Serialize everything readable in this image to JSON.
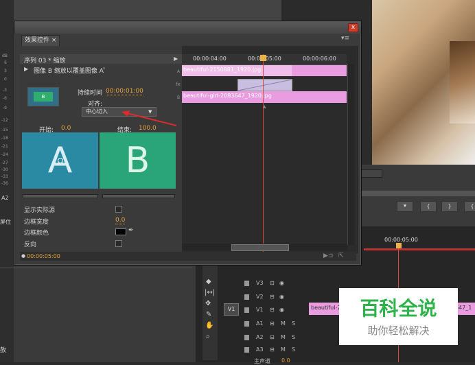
{
  "panel": {
    "tab_label": "效果控件 ×",
    "close_label": "x",
    "menu_label": "▾≡"
  },
  "sequence": {
    "label": "序列 03 * 缩放",
    "effect_name": "图像 B 缩放以覆盖图像 A",
    "effect_suffix": "◦"
  },
  "duration": {
    "label": "持续时间",
    "value": "00:00:01:00"
  },
  "align": {
    "label": "对齐:",
    "selected": "中心切入"
  },
  "thumb_label": "B",
  "start": {
    "label": "开始:",
    "value": "0.0"
  },
  "end": {
    "label": "结束:",
    "value": "100.0"
  },
  "preview": {
    "a": "A",
    "b": "B"
  },
  "props": [
    {
      "label": "显示实际源",
      "type": "checkbox"
    },
    {
      "label": "边框宽度",
      "value": "0.0"
    },
    {
      "label": "边框颜色",
      "type": "color",
      "color": "#000000"
    },
    {
      "label": "反向",
      "type": "checkbox"
    }
  ],
  "ruler": {
    "t1": "00:00:04:00",
    "t2": "00:00:05:00",
    "t3": "00:00:06:00"
  },
  "clips": {
    "a": "beautiful-2150881_1920.jpg",
    "b": "beautiful-girl-2083647_1920.jpg"
  },
  "track_letters": {
    "a": "A",
    "fx": "fx",
    "b": "B"
  },
  "status_time": "00:00:05:00",
  "timeline": {
    "time": "00:00:05:00",
    "tracks_video": [
      "V3",
      "V2",
      "V1"
    ],
    "tracks_audio": [
      "A1",
      "A2",
      "A3"
    ],
    "master_label": "主声道",
    "master_value": "0.0",
    "v1_source": "V1",
    "v1_clip_left": "beautiful-2",
    "v1_clip_right": "647_1"
  },
  "track_flags": {
    "m": "M",
    "s": "S"
  },
  "left_labels": {
    "a2": "A2",
    "side_a": "屏住",
    "bottom": "赦"
  },
  "db_scale": [
    "dB",
    "6",
    "3",
    "0",
    "-3",
    "-6",
    "-9",
    "-12",
    "-15",
    "-18",
    "-21",
    "-24",
    "-27",
    "-30",
    "-33",
    "-36"
  ],
  "transport": [
    "⯆",
    "{",
    "}",
    "{"
  ],
  "watermark": {
    "title": "百科全说",
    "subtitle": "助你轻松解决"
  },
  "colors": {
    "accent_orange": "#e8a33a",
    "playhead": "#d64a3c",
    "clip_pink": "#e99ce0",
    "watermark_green": "#2eb24a"
  }
}
